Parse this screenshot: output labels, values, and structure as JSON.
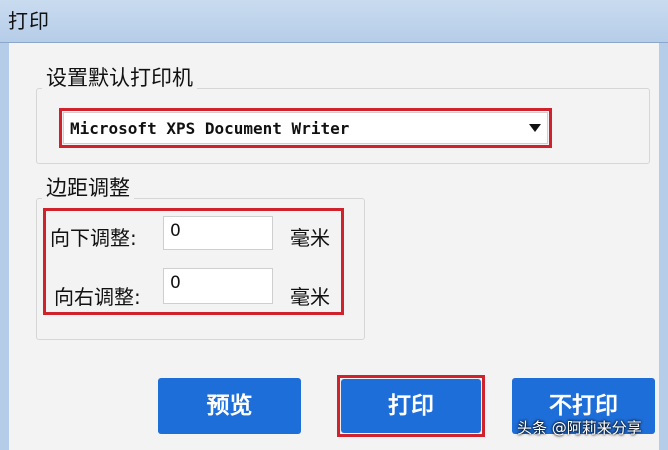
{
  "window": {
    "title": "打印"
  },
  "printer_group": {
    "legend": "设置默认打印机",
    "selected_printer": "Microsoft XPS Document Writer"
  },
  "margin_group": {
    "legend": "边距调整",
    "down": {
      "label": "向下调整:",
      "value": "0",
      "unit": "毫米"
    },
    "right": {
      "label": "向右调整:",
      "value": "0",
      "unit": "毫米"
    }
  },
  "buttons": {
    "preview": "预览",
    "print": "打印",
    "no_print": "不打印"
  },
  "watermark": "头条 @阿莉来分享",
  "colors": {
    "accent": "#1e6ed9",
    "highlight": "#d0222c",
    "titlebar": "#b6cde9"
  },
  "icons": {
    "select_arrow": "chevron-down-icon"
  }
}
